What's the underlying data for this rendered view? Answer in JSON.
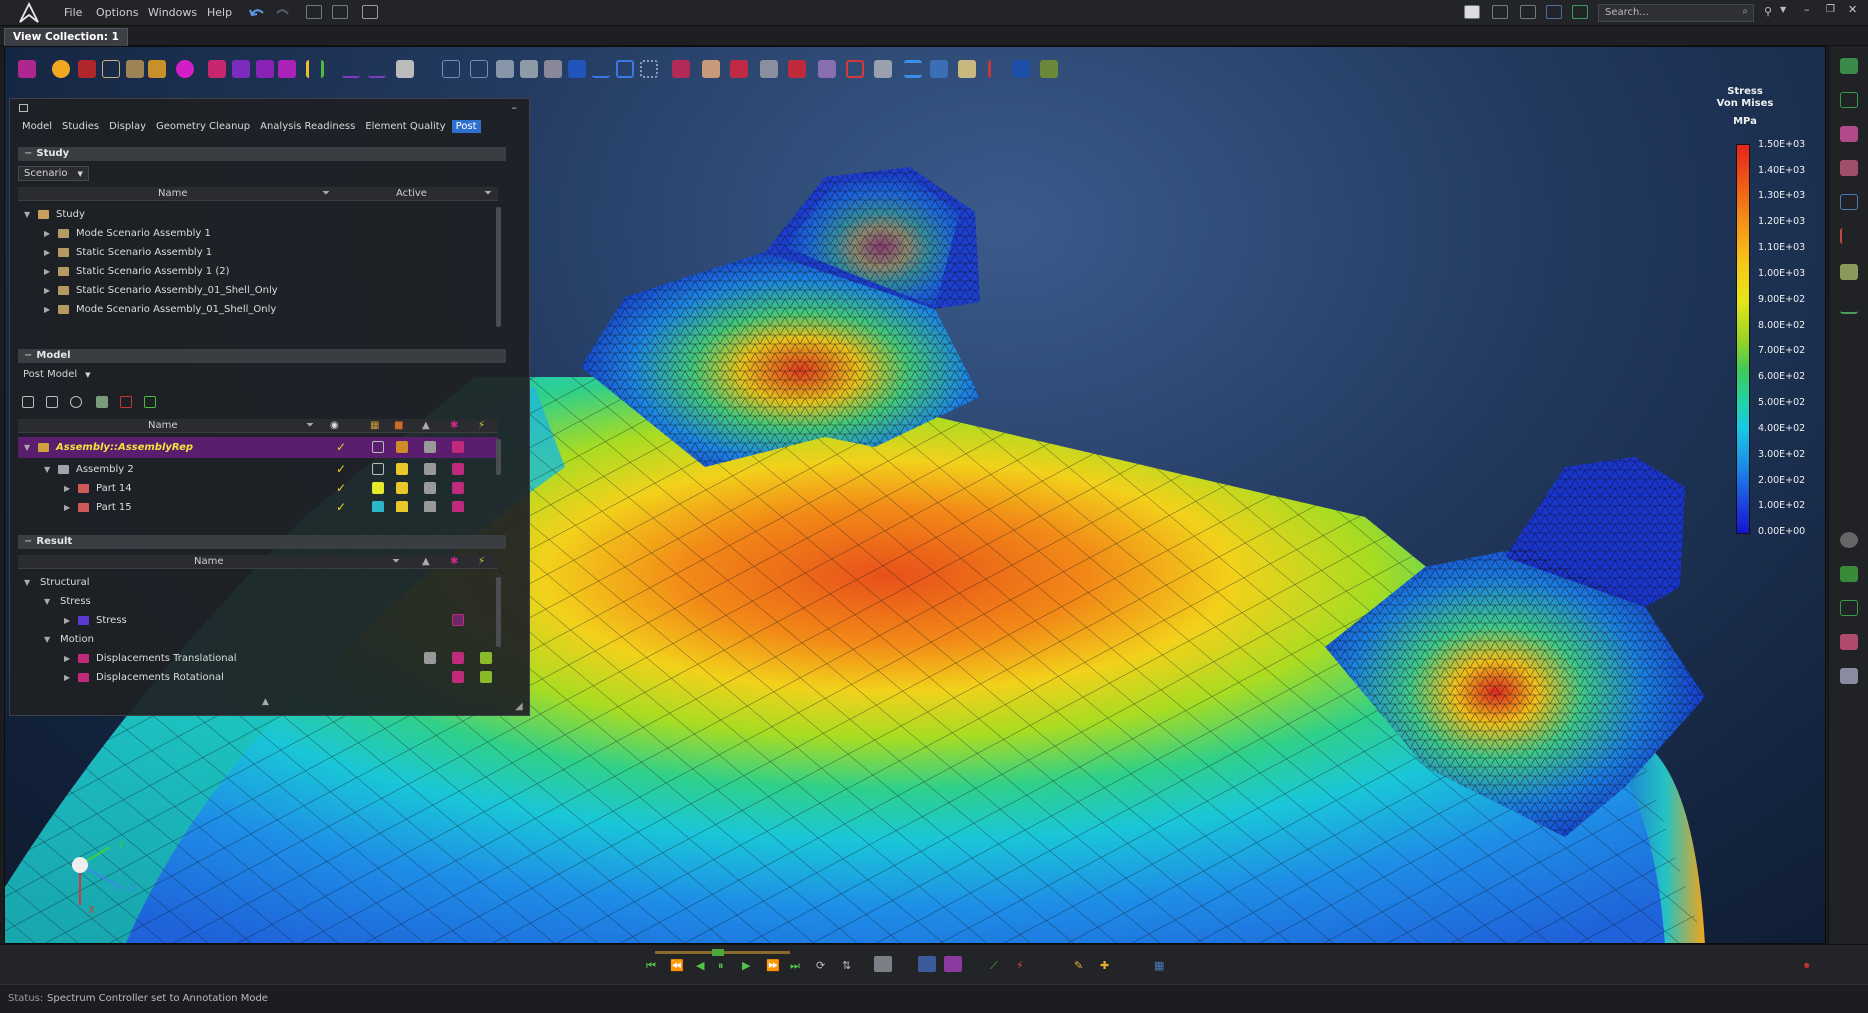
{
  "menubar": {
    "items": [
      "File",
      "Options",
      "Windows",
      "Help"
    ],
    "search_placeholder": "Search..."
  },
  "view_collection_tab": "View Collection: 1",
  "panel": {
    "tabs": [
      "Model",
      "Studies",
      "Display",
      "Geometry Cleanup",
      "Analysis Readiness",
      "Element Quality",
      "Post"
    ],
    "active_tab": "Post",
    "study_section": {
      "title": "Study",
      "dropdown": "Scenario",
      "columns": [
        "Name",
        "Active"
      ],
      "rows": [
        "Study",
        "Mode Scenario Assembly 1",
        "Static Scenario Assembly 1",
        "Static Scenario Assembly 1 (2)",
        "Static Scenario Assembly_01_Shell_Only",
        "Mode Scenario Assembly_01_Shell_Only"
      ]
    },
    "model_section": {
      "title": "Model",
      "dropdown": "Post Model",
      "columns": [
        "Name"
      ],
      "rows": [
        "Assembly::AssemblyRep",
        "Assembly 2",
        "Part 14",
        "Part 15"
      ]
    },
    "result_section": {
      "title": "Result",
      "columns": [
        "Name"
      ],
      "rows": [
        "Structural",
        "Stress",
        "Stress",
        "Motion",
        "Displacements Translational",
        "Displacements Rotational"
      ]
    }
  },
  "legend": {
    "title_lines": [
      "Stress",
      "Von Mises",
      "MPa"
    ],
    "values": [
      "1.50E+03",
      "1.40E+03",
      "1.30E+03",
      "1.20E+03",
      "1.10E+03",
      "1.00E+03",
      "9.00E+02",
      "8.00E+02",
      "7.00E+02",
      "6.00E+02",
      "5.00E+02",
      "4.00E+02",
      "3.00E+02",
      "2.00E+02",
      "1.00E+02",
      "0.00E+00"
    ]
  },
  "triad": {
    "x": "X",
    "y": "Y",
    "z": "Z"
  },
  "status": {
    "label": "Status:",
    "text": "Spectrum Controller set to Annotation Mode"
  },
  "colors": {
    "accent": "#2f6fd0",
    "selection": "#5b1d6e",
    "selection_text": "#f5e23c",
    "check": "#f0d020"
  }
}
